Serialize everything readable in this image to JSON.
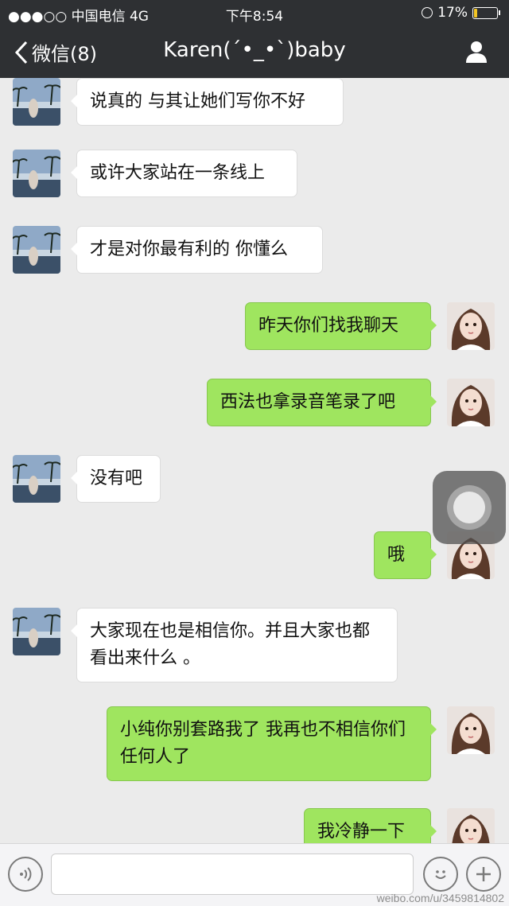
{
  "status_bar": {
    "carrier": "●●●○○ 中国电信  4G",
    "time": "下午8:54",
    "battery": "17%",
    "battery_level": 0.17,
    "battery_color": "#f3c523"
  },
  "nav": {
    "back_label": "微信(8)",
    "title": "Karen(´•_•`)baby",
    "person_icon": "person-icon"
  },
  "messages": [
    {
      "side": "in",
      "text": "说真的 与其让她们写你不好"
    },
    {
      "side": "in",
      "text": "或许大家站在一条线上"
    },
    {
      "side": "in",
      "text": "才是对你最有利的 你懂么"
    },
    {
      "side": "out",
      "text": "昨天你们找我聊天"
    },
    {
      "side": "out",
      "text": "西法也拿录音笔录了吧"
    },
    {
      "side": "in",
      "text": "没有吧"
    },
    {
      "side": "out",
      "text": "哦"
    },
    {
      "side": "in",
      "text": "大家现在也是相信你。并且大家也都看出来什么 。"
    },
    {
      "side": "out",
      "text": "小纯你别套路我了 我再也不相信你们任何人了"
    },
    {
      "side": "out",
      "text": "我冷静一下"
    }
  ],
  "input_bar": {
    "voice_icon": "voice-icon",
    "emoji_icon": "emoji-icon",
    "plus_icon": "plus-icon"
  },
  "watermark": "weibo.com/u/3459814802",
  "colors": {
    "outgoing_bubble": "#9fe55f",
    "incoming_bubble": "#ffffff",
    "nav_background": "#2e3033",
    "chat_background": "#ebebeb"
  }
}
